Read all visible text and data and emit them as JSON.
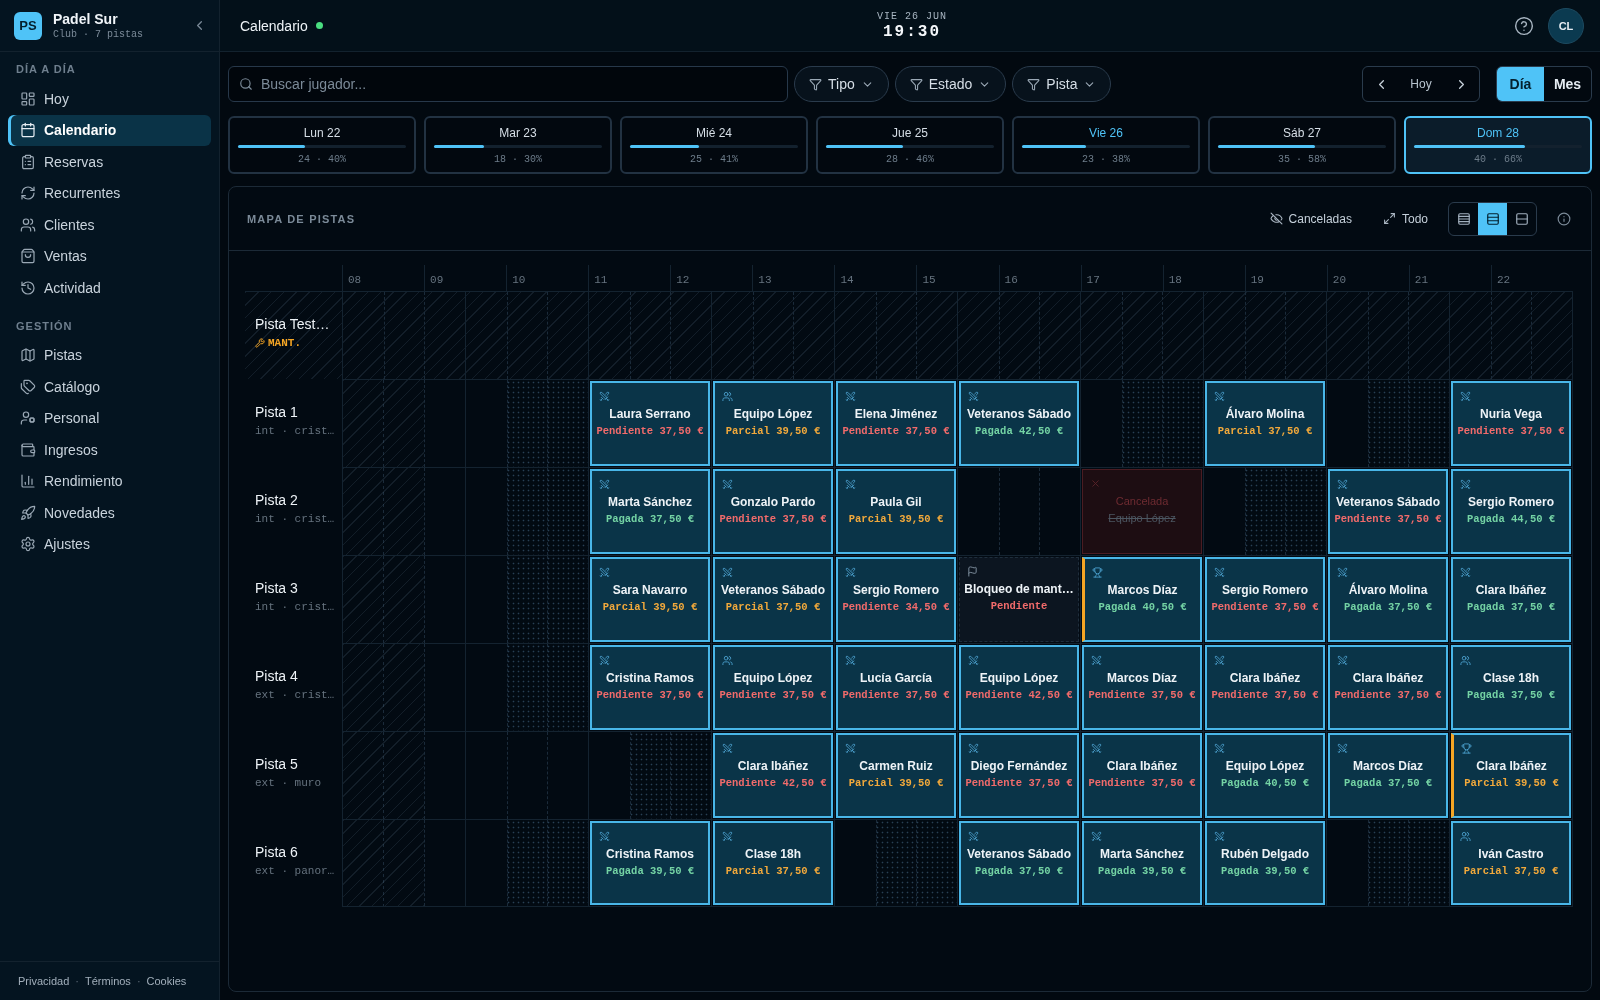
{
  "sidebar": {
    "logo": "PS",
    "club_name": "Padel Sur",
    "club_meta": "Club · 7 pistas",
    "sections": [
      {
        "title": "DÍA A DÍA",
        "items": [
          {
            "label": "Hoy",
            "selected": false
          },
          {
            "label": "Calendario",
            "selected": true
          },
          {
            "label": "Reservas",
            "selected": false
          },
          {
            "label": "Recurrentes",
            "selected": false
          },
          {
            "label": "Clientes",
            "selected": false
          },
          {
            "label": "Ventas",
            "selected": false
          },
          {
            "label": "Actividad",
            "selected": false
          }
        ]
      },
      {
        "title": "GESTIÓN",
        "items": [
          {
            "label": "Pistas",
            "selected": false
          },
          {
            "label": "Catálogo",
            "selected": false
          },
          {
            "label": "Personal",
            "selected": false
          },
          {
            "label": "Ingresos",
            "selected": false
          },
          {
            "label": "Rendimiento",
            "selected": false
          },
          {
            "label": "Novedades",
            "selected": false
          },
          {
            "label": "Ajustes",
            "selected": false
          }
        ]
      }
    ],
    "footer_links": [
      "Privacidad",
      "Términos",
      "Cookies"
    ],
    "footer_separator": "·"
  },
  "topbar": {
    "title": "Calendario",
    "live": true,
    "date": "VIE 26 JUN",
    "time": "19:30",
    "avatar": "CL"
  },
  "filters": {
    "search": {
      "placeholder": "Buscar jugador..."
    },
    "buttons": [
      "Tipo",
      "Estado",
      "Pista"
    ],
    "today": "Hoy",
    "views": [
      {
        "label": "Día",
        "selected": true
      },
      {
        "label": "Mes",
        "selected": false
      }
    ]
  },
  "days": [
    {
      "label": "Lun 22",
      "stat": "24 · 40%",
      "level": 0.4,
      "today": false,
      "selected": false
    },
    {
      "label": "Mar 23",
      "stat": "18 · 30%",
      "level": 0.3,
      "today": false,
      "selected": false
    },
    {
      "label": "Mié 24",
      "stat": "25 · 41%",
      "level": 0.41,
      "today": false,
      "selected": false
    },
    {
      "label": "Jue 25",
      "stat": "28 · 46%",
      "level": 0.46,
      "today": false,
      "selected": false
    },
    {
      "label": "Vie 26",
      "stat": "23 · 38%",
      "level": 0.38,
      "today": true,
      "selected": false
    },
    {
      "label": "Sáb 27",
      "stat": "35 · 58%",
      "level": 0.58,
      "today": false,
      "selected": false
    },
    {
      "label": "Dom 28",
      "stat": "40 · 66%",
      "level": 0.66,
      "today": false,
      "selected": true
    }
  ],
  "court_map": {
    "title": "MAPA DE PISTAS",
    "actions": [
      "Canceladas",
      "Todo"
    ],
    "density": [
      {
        "selected": false
      },
      {
        "selected": true
      },
      {
        "selected": false
      }
    ],
    "hours": [
      "08",
      "09",
      "10",
      "11",
      "12",
      "13",
      "14",
      "15",
      "16",
      "17",
      "18",
      "19",
      "20",
      "21",
      "22"
    ],
    "courts": [
      {
        "name": "Pista Test…",
        "maintenance": true,
        "badge": "MANT."
      },
      {
        "name": "Pista 1",
        "detail": "int · crist…",
        "maintenance": false,
        "slots": [
          {
            "kind": "closed"
          },
          {
            "kind": "free",
            "dotted": true
          },
          {
            "kind": "match",
            "name": "Laura Serrano",
            "payment": "Pendiente 37,50 €",
            "color": "#f26b6b"
          },
          {
            "kind": "group",
            "name": "Equipo López",
            "payment": "Parcial 39,50 €",
            "color": "#f2a93b"
          },
          {
            "kind": "match",
            "name": "Elena Jiménez",
            "payment": "Pendiente 37,50 €",
            "color": "#f26b6b"
          },
          {
            "kind": "match",
            "name": "Veteranos Sábado",
            "payment": "Pagada 42,50 €",
            "color": "#74d3a4"
          },
          {
            "kind": "free",
            "dotted": true
          },
          {
            "kind": "match",
            "name": "Álvaro Molina",
            "payment": "Parcial 37,50 €",
            "color": "#f2a93b"
          },
          {
            "kind": "free",
            "dotted": true
          },
          {
            "kind": "match",
            "name": "Nuria Vega",
            "payment": "Pendiente 37,50 €",
            "color": "#f26b6b"
          }
        ]
      },
      {
        "name": "Pista 2",
        "detail": "int · crist…",
        "maintenance": false,
        "slots": [
          {
            "kind": "closed"
          },
          {
            "kind": "free",
            "dotted": true
          },
          {
            "kind": "match",
            "name": "Marta Sánchez",
            "payment": "Pagada 37,50 €",
            "color": "#74d3a4"
          },
          {
            "kind": "match",
            "name": "Gonzalo Pardo",
            "payment": "Pendiente 37,50 €",
            "color": "#f26b6b"
          },
          {
            "kind": "match",
            "name": "Paula Gil",
            "payment": "Parcial 39,50 €",
            "color": "#f2a93b"
          },
          {
            "kind": "free",
            "dotted": false
          },
          {
            "kind": "cancelled",
            "status": "Cancelada",
            "name": "Equipo López"
          },
          {
            "kind": "free",
            "dotted": true
          },
          {
            "kind": "match",
            "name": "Veteranos Sábado",
            "payment": "Pendiente 37,50 €",
            "color": "#f26b6b"
          },
          {
            "kind": "match",
            "name": "Sergio Romero",
            "payment": "Pagada 44,50 €",
            "color": "#74d3a4"
          }
        ]
      },
      {
        "name": "Pista 3",
        "detail": "int · crist…",
        "maintenance": false,
        "slots": [
          {
            "kind": "closed"
          },
          {
            "kind": "free",
            "dotted": true
          },
          {
            "kind": "match",
            "name": "Sara Navarro",
            "payment": "Parcial 39,50 €",
            "color": "#f2a93b"
          },
          {
            "kind": "match",
            "name": "Veteranos Sábado",
            "payment": "Parcial 37,50 €",
            "color": "#f2a93b"
          },
          {
            "kind": "match",
            "name": "Sergio Romero",
            "payment": "Pendiente 34,50 €",
            "color": "#f26b6b"
          },
          {
            "kind": "block",
            "name": "Bloqueo de mant…",
            "payment": "Pendiente",
            "color": "#f26b6b"
          },
          {
            "kind": "tournament",
            "name": "Marcos Díaz",
            "payment": "Pagada 40,50 €",
            "color": "#74d3a4"
          },
          {
            "kind": "match",
            "name": "Sergio Romero",
            "payment": "Pendiente 37,50 €",
            "color": "#f26b6b"
          },
          {
            "kind": "match",
            "name": "Álvaro Molina",
            "payment": "Pagada 37,50 €",
            "color": "#74d3a4"
          },
          {
            "kind": "match",
            "name": "Clara Ibáñez",
            "payment": "Pagada 37,50 €",
            "color": "#74d3a4"
          }
        ]
      },
      {
        "name": "Pista 4",
        "detail": "ext · crist…",
        "maintenance": false,
        "slots": [
          {
            "kind": "closed"
          },
          {
            "kind": "free",
            "dotted": true
          },
          {
            "kind": "match",
            "name": "Cristina Ramos",
            "payment": "Pendiente 37,50 €",
            "color": "#f26b6b"
          },
          {
            "kind": "group",
            "name": "Equipo López",
            "payment": "Pendiente 37,50 €",
            "color": "#f26b6b"
          },
          {
            "kind": "match",
            "name": "Lucía García",
            "payment": "Pendiente 37,50 €",
            "color": "#f26b6b"
          },
          {
            "kind": "match",
            "name": "Equipo López",
            "payment": "Pendiente 42,50 €",
            "color": "#f26b6b"
          },
          {
            "kind": "match",
            "name": "Marcos Díaz",
            "payment": "Pendiente 37,50 €",
            "color": "#f26b6b"
          },
          {
            "kind": "match",
            "name": "Clara Ibáñez",
            "payment": "Pendiente 37,50 €",
            "color": "#f26b6b"
          },
          {
            "kind": "match",
            "name": "Clara Ibáñez",
            "payment": "Pendiente 37,50 €",
            "color": "#f26b6b"
          },
          {
            "kind": "group",
            "name": "Clase 18h",
            "payment": "Pagada 37,50 €",
            "color": "#74d3a4"
          }
        ]
      },
      {
        "name": "Pista 5",
        "detail": "ext · muro",
        "maintenance": false,
        "slots": [
          {
            "kind": "closed"
          },
          {
            "kind": "free",
            "dotted": false
          },
          {
            "kind": "free",
            "dotted": true
          },
          {
            "kind": "match",
            "name": "Clara Ibáñez",
            "payment": "Pendiente 42,50 €",
            "color": "#f26b6b"
          },
          {
            "kind": "match",
            "name": "Carmen Ruiz",
            "payment": "Parcial 39,50 €",
            "color": "#f2a93b"
          },
          {
            "kind": "match",
            "name": "Diego Fernández",
            "payment": "Pendiente 37,50 €",
            "color": "#f26b6b"
          },
          {
            "kind": "match",
            "name": "Clara Ibáñez",
            "payment": "Pendiente 37,50 €",
            "color": "#f26b6b"
          },
          {
            "kind": "match",
            "name": "Equipo López",
            "payment": "Pagada 40,50 €",
            "color": "#74d3a4"
          },
          {
            "kind": "match",
            "name": "Marcos Díaz",
            "payment": "Pagada 37,50 €",
            "color": "#74d3a4"
          },
          {
            "kind": "tournament",
            "name": "Clara Ibáñez",
            "payment": "Parcial 39,50 €",
            "color": "#f2a93b"
          }
        ]
      },
      {
        "name": "Pista 6",
        "detail": "ext · panor…",
        "maintenance": false,
        "slots": [
          {
            "kind": "closed"
          },
          {
            "kind": "free",
            "dotted": true
          },
          {
            "kind": "match",
            "name": "Cristina Ramos",
            "payment": "Pagada 39,50 €",
            "color": "#74d3a4"
          },
          {
            "kind": "match",
            "name": "Clase 18h",
            "payment": "Parcial 37,50 €",
            "color": "#f2a93b"
          },
          {
            "kind": "free",
            "dotted": true
          },
          {
            "kind": "match",
            "name": "Veteranos Sábado",
            "payment": "Pagada 37,50 €",
            "color": "#74d3a4"
          },
          {
            "kind": "match",
            "name": "Marta Sánchez",
            "payment": "Pagada 39,50 €",
            "color": "#74d3a4"
          },
          {
            "kind": "match",
            "name": "Rubén Delgado",
            "payment": "Pagada 39,50 €",
            "color": "#74d3a4"
          },
          {
            "kind": "free",
            "dotted": true
          },
          {
            "kind": "group",
            "name": "Iván Castro",
            "payment": "Parcial 37,50 €",
            "color": "#f2a93b"
          }
        ]
      }
    ]
  }
}
